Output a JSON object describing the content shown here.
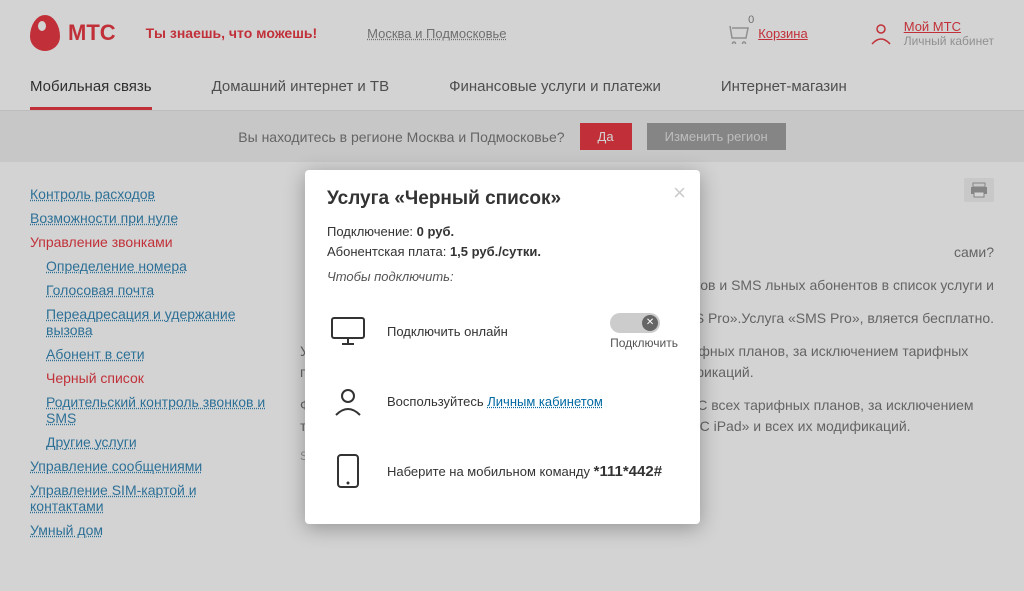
{
  "header": {
    "logo": "МТС",
    "slogan": "Ты знаешь, что можешь!",
    "region": "Москва и Подмосковье",
    "cart_count": "0",
    "cart_label": "Корзина",
    "mymts_link": "Мой МТС",
    "mymts_sub": "Личный кабинет"
  },
  "nav": {
    "mobile": "Мобильная связь",
    "internet": "Домашний интернет и ТВ",
    "finance": "Финансовые услуги и платежи",
    "shop": "Интернет-магазин"
  },
  "region_bar": {
    "text": "Вы находитесь в регионе Москва и Подмосковье?",
    "yes": "Да",
    "change": "Изменить регион"
  },
  "sidebar": {
    "s0": "Контроль расходов",
    "s1": "Возможности при нуле",
    "s2": "Управление звонками",
    "s3": "Определение номера",
    "s4": "Голосовая почта",
    "s5": "Переадресация и удержание вызова",
    "s6": "Абонент в сети",
    "s7": "Черный список",
    "s8": "Родительский контроль звонков и SMS",
    "s9": "Другие услуги",
    "s10": "Управление сообщениями",
    "s11": "Управление SIM-картой и контактами",
    "s12": "Умный дом"
  },
  "main": {
    "q": "сами?",
    "p1": "окировки входящих звонков и SMS льных абонентов в список услуги и",
    "p2": "луги «SMS Pro».Услуга «SMS Pro», вляется бесплатно.",
    "p3": "Услуга «Черный список» доступна абонентам МТС всех тарифных планов, за исключением тарифных планов «Коннект», «Онлайнер», «МТС iPad» и всех их модификаций.",
    "p4": "Функция блокировки входящих SMS доступна абонентам МТС всех тарифных планов, за исключением тарифных планов «Классный», «Коннект», «Онлайнер», «МТС iPad» и всех их модификаций.",
    "note": "SMS Pro = СМС Про."
  },
  "modal": {
    "title": "Услуга «Черный список»",
    "conn_label": "Подключение: ",
    "conn_value": "0 руб.",
    "fee_label": "Абонентская плата: ",
    "fee_value": "1,5 руб./сутки.",
    "instr": "Чтобы подключить:",
    "online": "Подключить онлайн",
    "toggle_label": "Подключить",
    "use": "Воспользуйтесь ",
    "lk": "Личным кабинетом",
    "dial": "Наберите на мобильном команду ",
    "ussd": "*111*442#"
  }
}
